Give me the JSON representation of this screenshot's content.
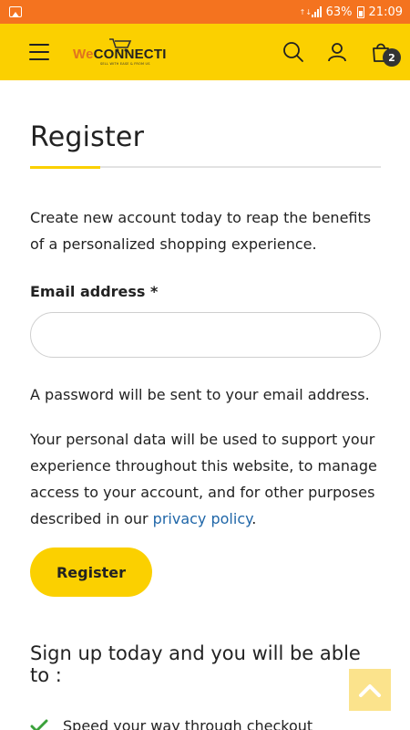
{
  "status_bar": {
    "battery": "63%",
    "time": "21:09",
    "icons": [
      "gallery-icon",
      "data-icon",
      "signal-icon",
      "battery-icon"
    ]
  },
  "header": {
    "logo": {
      "part1": "We",
      "part2": "CONNECTI",
      "tagline": "SELL WITH EASE & FROM US"
    },
    "cart_count": "2",
    "icons": [
      "menu-icon",
      "search-icon",
      "user-icon",
      "shopping-bag-icon"
    ]
  },
  "page": {
    "title": "Register",
    "intro": "Create new account today to reap the benefits of a personalized shopping experience.",
    "email_label": "Email address *",
    "email_value": "",
    "password_note": "A password will be sent to your email address.",
    "privacy_text": "Your personal data will be used to support your experience throughout this website, to manage access to your account, and for other purposes described in our ",
    "privacy_link": "privacy policy",
    "privacy_end": ".",
    "register_button": "Register",
    "signup_heading": "Sign up today and you will be able to :",
    "benefits": [
      "Speed your way through checkout"
    ]
  },
  "colors": {
    "status_bar": "#f4731f",
    "header": "#fbd000",
    "accent": "#fbd000",
    "link": "#1f66a8",
    "check": "#3aa13a"
  }
}
